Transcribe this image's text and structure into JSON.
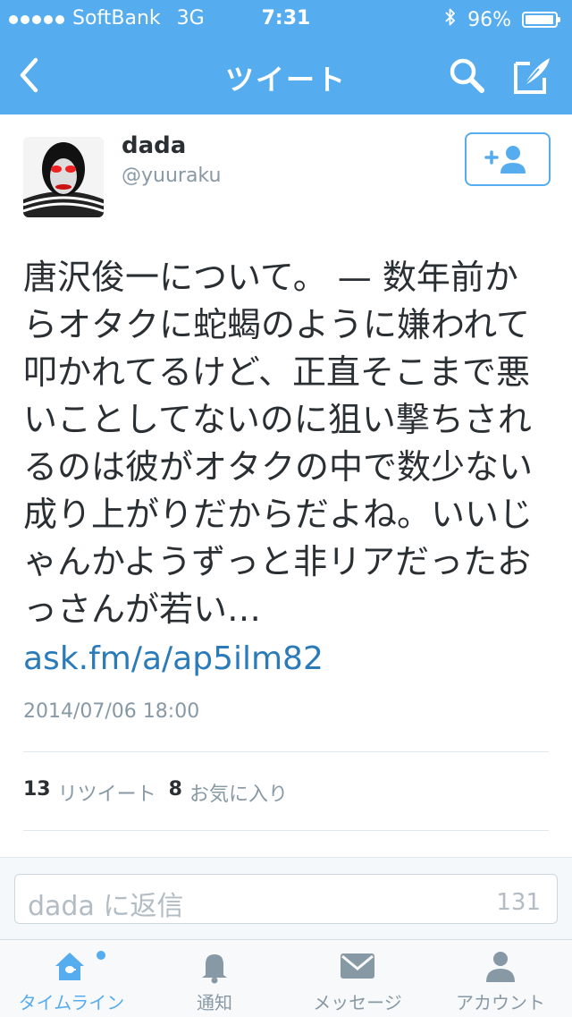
{
  "status_bar": {
    "carrier": "SoftBank",
    "network": "3G",
    "time": "7:31",
    "battery": "96%",
    "battery_level": 0.96
  },
  "nav": {
    "title": "ツイート",
    "back_icon": "chevron-left-icon",
    "search_icon": "search-icon",
    "compose_icon": "compose-icon"
  },
  "tweet": {
    "user_name": "dada",
    "user_handle": "@yuuraku",
    "text": "唐沢俊一について。 — 数年前からオタクに蛇蝎のように嫌われて叩かれてるけど、正直そこまで悪いことしてないのに狙い撃ちされるのは彼がオタクの中で数少ない成り上がりだからだよね。いいじゃんかようずっと非リアだったおっさんが若い…",
    "link": "ask.fm/a/ap5ilm82",
    "timestamp": "2014/07/06 18:00",
    "retweet_count": "13",
    "retweet_label": "リツイート",
    "favorite_count": "8",
    "favorite_label": "お気に入り"
  },
  "reply": {
    "placeholder": "dada に返信",
    "char_count": "131"
  },
  "tabs": [
    {
      "label": "タイムライン",
      "icon": "home-icon",
      "active": true
    },
    {
      "label": "通知",
      "icon": "bell-icon",
      "active": false
    },
    {
      "label": "メッセージ",
      "icon": "envelope-icon",
      "active": false
    },
    {
      "label": "アカウント",
      "icon": "person-icon",
      "active": false
    }
  ],
  "colors": {
    "brand": "#55acee",
    "link": "#2b7bb9",
    "muted": "#8899a6"
  }
}
